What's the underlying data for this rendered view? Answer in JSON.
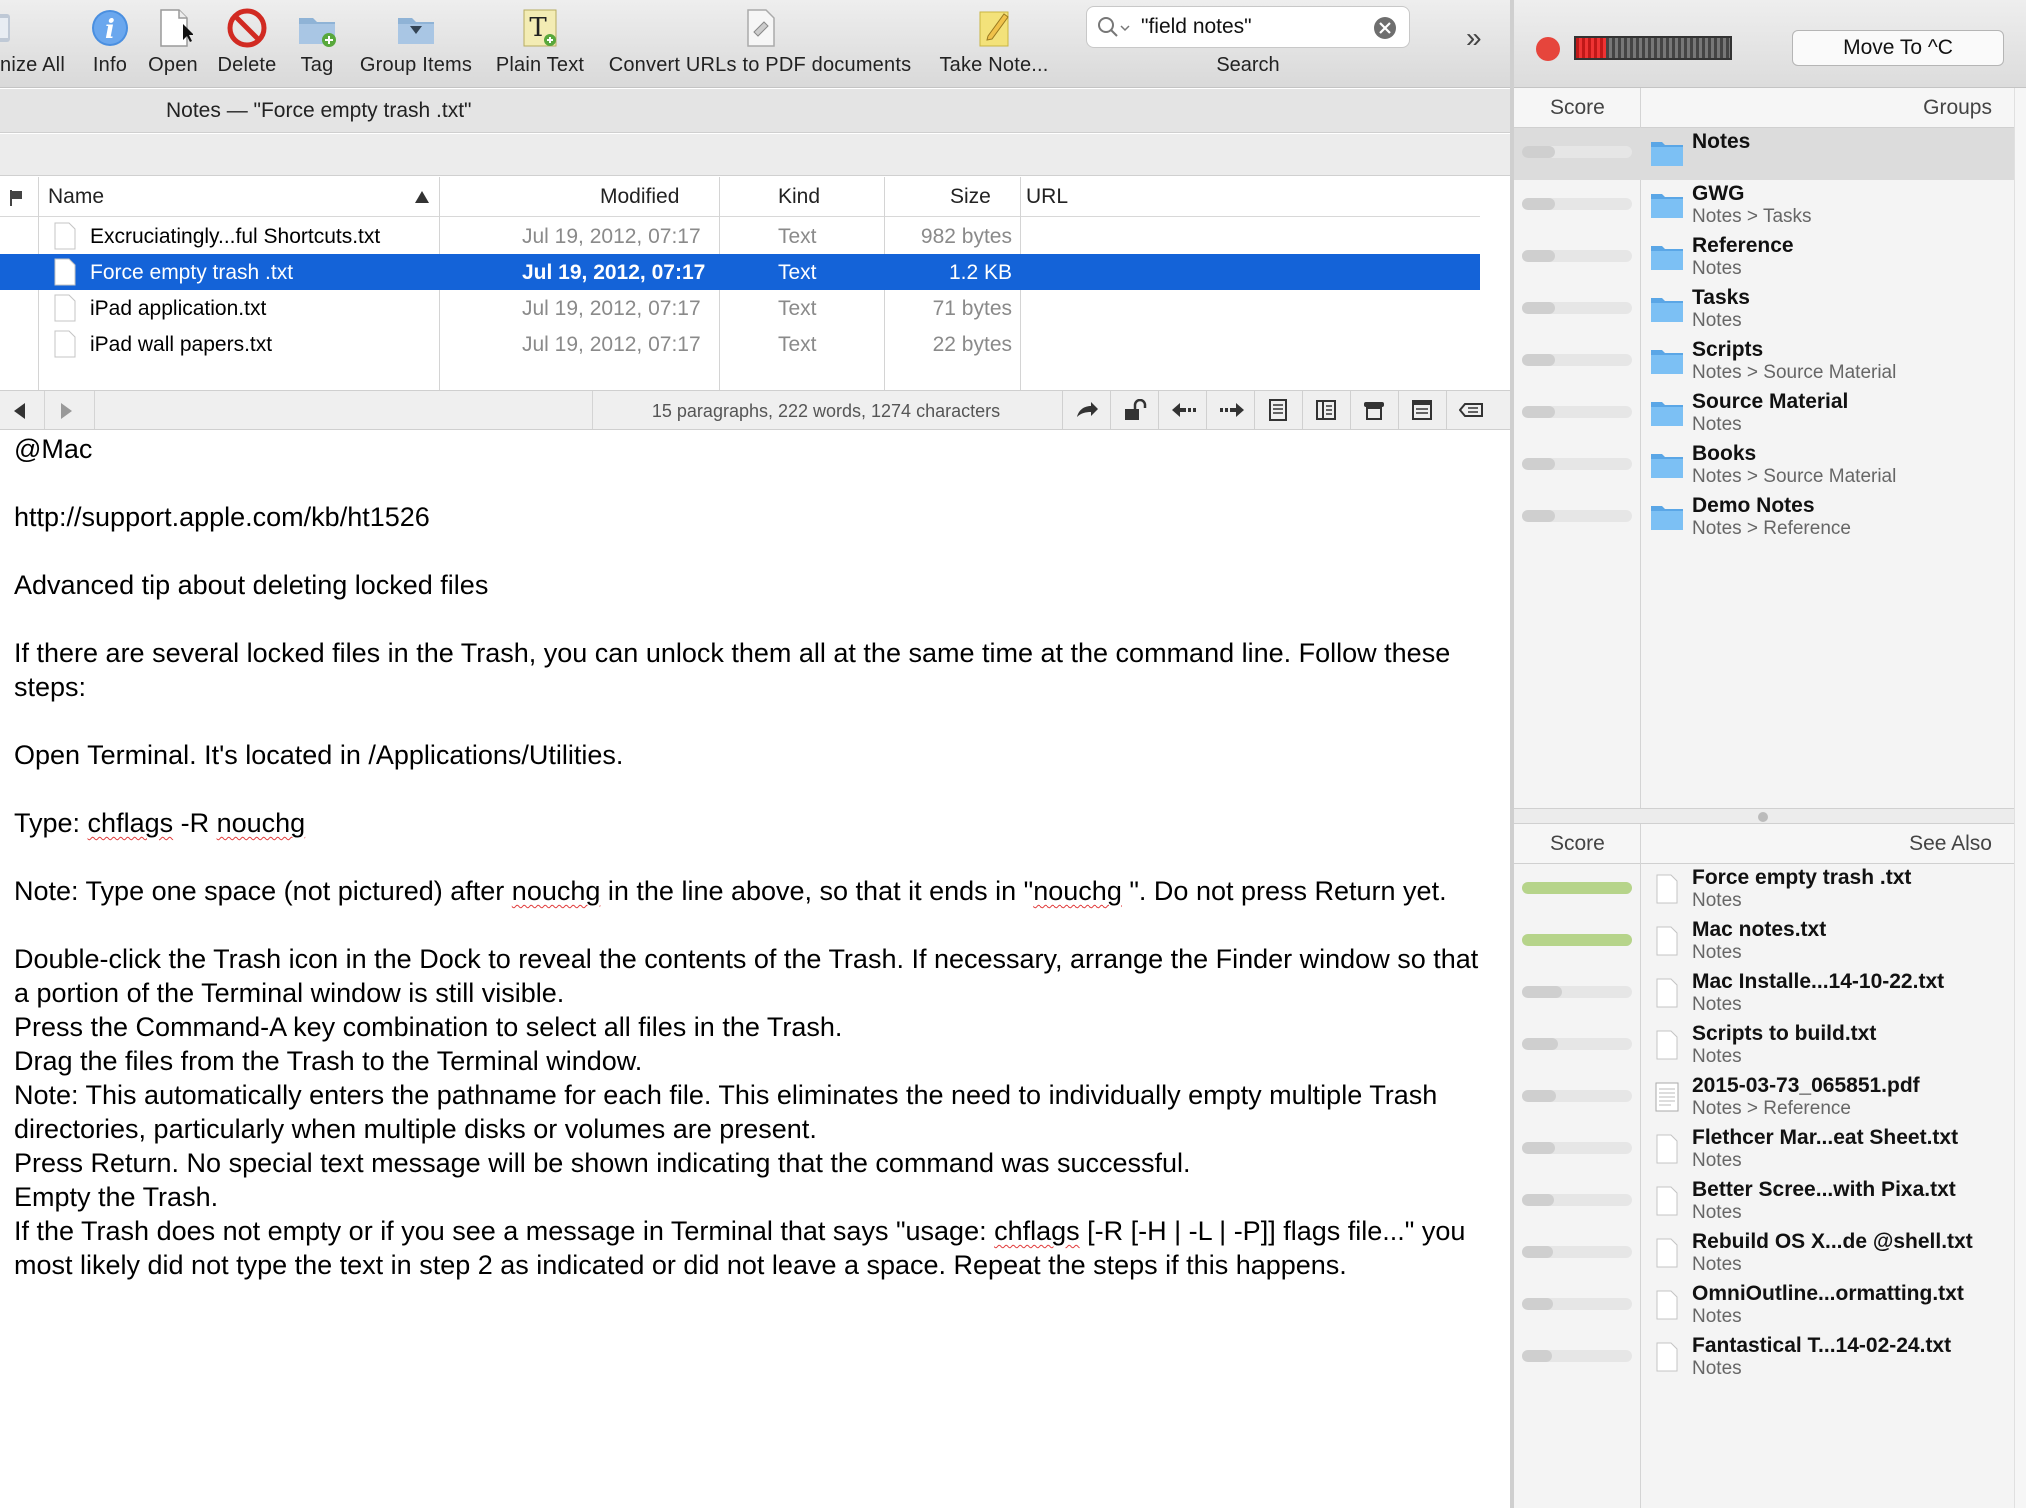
{
  "toolbar": {
    "items": [
      {
        "label": "nize All",
        "icon": "summarize-icon"
      },
      {
        "label": "Info",
        "icon": "info-icon"
      },
      {
        "label": "Open",
        "icon": "document-icon"
      },
      {
        "label": "Delete",
        "icon": "delete-icon"
      },
      {
        "label": "Tag",
        "icon": "tag-folder-icon"
      },
      {
        "label": "Group Items",
        "icon": "group-folder-icon"
      },
      {
        "label": "Plain Text",
        "icon": "plain-text-icon"
      },
      {
        "label": "Convert URLs to PDF documents",
        "icon": "convert-pdf-icon"
      },
      {
        "label": "Take Note...",
        "icon": "note-pad-icon"
      }
    ],
    "search_value": "\"field notes\"",
    "search_label": "Search",
    "overflow": "»"
  },
  "pathbar": {
    "title": "Notes — \"Force empty trash .txt\""
  },
  "list": {
    "columns": {
      "name": "Name",
      "modified": "Modified",
      "kind": "Kind",
      "size": "Size",
      "url": "URL"
    },
    "rows": [
      {
        "name": "Excruciatingly...ful Shortcuts.txt",
        "modified": "Jul 19, 2012, 07:17",
        "kind": "Text",
        "size": "982 bytes",
        "url": ""
      },
      {
        "name": "Force empty trash .txt",
        "modified": "Jul 19, 2012, 07:17",
        "kind": "Text",
        "size": "1.2 KB",
        "url": ""
      },
      {
        "name": "iPad application.txt",
        "modified": "Jul 19, 2012, 07:17",
        "kind": "Text",
        "size": "71 bytes",
        "url": ""
      },
      {
        "name": "iPad wall papers.txt",
        "modified": "Jul 19, 2012, 07:17",
        "kind": "Text",
        "size": "22 bytes",
        "url": ""
      }
    ]
  },
  "statusbar": {
    "stats": "15 paragraphs, 222 words, 1274 characters"
  },
  "document": {
    "paragraphs": [
      "@Mac",
      "",
      "http://support.apple.com/kb/ht1526",
      "",
      "Advanced tip about deleting locked files",
      "",
      "If there are several locked files in the Trash, you can unlock them all at the same time at the command line. Follow these steps:",
      "",
      "Open Terminal. It's located in /Applications/Utilities.",
      "",
      "Type: chflags -R nouchg",
      "",
      "Note: Type one space (not pictured) after nouchg in the line above, so that it ends in \"nouchg \". Do not press Return yet.",
      "",
      "Double-click the Trash icon in the Dock to reveal the contents of the Trash. If necessary, arrange the Finder window so that a portion of the Terminal window is still visible.",
      "Press the Command-A key combination to select all files in the Trash.",
      "Drag the files from the Trash to the Terminal window.",
      "Note: This automatically enters the pathname for each file. This eliminates the need to individually empty multiple Trash directories, particularly when multiple disks or volumes are present.",
      "Press Return. No special text message will be shown indicating that the command was successful.",
      "Empty the Trash.",
      "If the Trash does not empty or if you see a message in Terminal that says \"usage: chflags [-R [-H | -L | -P]] flags file...\" you most likely did not type the text in step 2 as indicated or did not leave a space. Repeat the steps if this happens."
    ],
    "misspelled": [
      "chflags",
      "nouchg"
    ]
  },
  "right": {
    "move_to": "Move To ^C",
    "score_label": "Score",
    "groups_label": "Groups",
    "see_also_label": "See Also",
    "groups": [
      {
        "title": "Notes",
        "sub": "",
        "score": 0.0
      },
      {
        "title": "GWG",
        "sub": "Notes > Tasks",
        "score": 0.0
      },
      {
        "title": "Reference",
        "sub": "Notes",
        "score": 0.0
      },
      {
        "title": "Tasks",
        "sub": "Notes",
        "score": 0.0
      },
      {
        "title": "Scripts",
        "sub": "Notes > Source Material",
        "score": 0.0
      },
      {
        "title": "Source Material",
        "sub": "Notes",
        "score": 0.0
      },
      {
        "title": "Books",
        "sub": "Notes > Source Material",
        "score": 0.0
      },
      {
        "title": "Demo Notes",
        "sub": "Notes > Reference",
        "score": 0.0
      }
    ],
    "see_also": [
      {
        "title": "Force empty trash .txt",
        "sub": "Notes",
        "score": 1.0,
        "kind": "txt"
      },
      {
        "title": "Mac notes.txt",
        "sub": "Notes",
        "score": 1.0,
        "kind": "txt"
      },
      {
        "title": "Mac Installe...14-10-22.txt",
        "sub": "Notes",
        "score": 0.36,
        "kind": "txt"
      },
      {
        "title": "Scripts to build.txt",
        "sub": "Notes",
        "score": 0.33,
        "kind": "txt"
      },
      {
        "title": "2015-03-73_065851.pdf",
        "sub": "Notes > Reference",
        "score": 0.31,
        "kind": "pdf"
      },
      {
        "title": "Flethcer Mar...eat Sheet.txt",
        "sub": "Notes",
        "score": 0.3,
        "kind": "txt"
      },
      {
        "title": "Better Scree...with Pixa.txt",
        "sub": "Notes",
        "score": 0.29,
        "kind": "txt"
      },
      {
        "title": "Rebuild OS X...de @shell.txt",
        "sub": "Notes",
        "score": 0.28,
        "kind": "txt"
      },
      {
        "title": "OmniOutline...ormatting.txt",
        "sub": "Notes",
        "score": 0.28,
        "kind": "txt"
      },
      {
        "title": "Fantastical T...14-02-24.txt",
        "sub": "Notes",
        "score": 0.27,
        "kind": "txt"
      }
    ]
  },
  "colors": {
    "selection": "#1463d8",
    "folder": "#5ab0ee",
    "score_green": "#b6d48a",
    "close_red": "#e6453c"
  }
}
